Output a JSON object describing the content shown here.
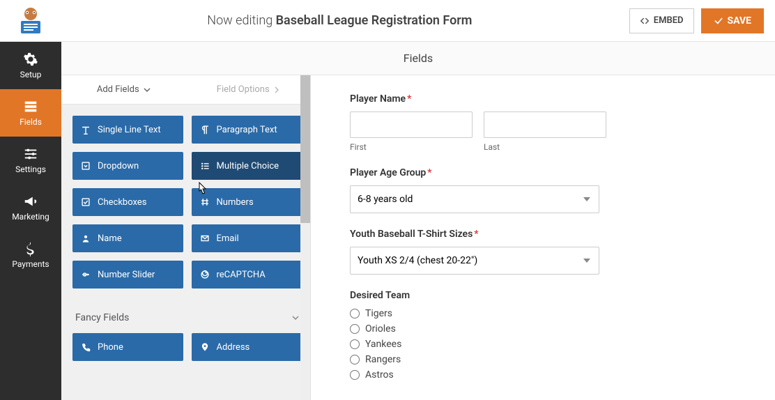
{
  "header": {
    "editing_prefix": "Now editing ",
    "form_title": "Baseball League Registration Form",
    "embed_label": "EMBED",
    "save_label": "SAVE"
  },
  "sidenav": {
    "items": [
      {
        "label": "Setup",
        "icon": "gear"
      },
      {
        "label": "Fields",
        "icon": "form"
      },
      {
        "label": "Settings",
        "icon": "sliders"
      },
      {
        "label": "Marketing",
        "icon": "bullhorn"
      },
      {
        "label": "Payments",
        "icon": "dollar"
      }
    ]
  },
  "panel_title": "Fields",
  "left": {
    "tab_add": "Add Fields",
    "tab_options": "Field Options",
    "standard_fields": [
      {
        "label": "Single Line Text",
        "icon": "text"
      },
      {
        "label": "Paragraph Text",
        "icon": "paragraph"
      },
      {
        "label": "Dropdown",
        "icon": "caret-square"
      },
      {
        "label": "Multiple Choice",
        "icon": "list"
      },
      {
        "label": "Checkboxes",
        "icon": "check-square"
      },
      {
        "label": "Numbers",
        "icon": "hash"
      },
      {
        "label": "Name",
        "icon": "user"
      },
      {
        "label": "Email",
        "icon": "mail"
      },
      {
        "label": "Number Slider",
        "icon": "slider"
      },
      {
        "label": "reCAPTCHA",
        "icon": "google"
      }
    ],
    "fancy_section": "Fancy Fields",
    "fancy_fields": [
      {
        "label": "Phone",
        "icon": "phone"
      },
      {
        "label": "Address",
        "icon": "pin"
      }
    ]
  },
  "form": {
    "player_name": {
      "label": "Player Name",
      "first_sub": "First",
      "last_sub": "Last"
    },
    "age_group": {
      "label": "Player Age Group",
      "value": "6-8 years old"
    },
    "tshirt": {
      "label": "Youth Baseball T-Shirt Sizes",
      "value": "Youth XS  2/4 (chest 20-22\")"
    },
    "team": {
      "label": "Desired Team",
      "options": [
        "Tigers",
        "Orioles",
        "Yankees",
        "Rangers",
        "Astros"
      ]
    }
  },
  "colors": {
    "accent": "#e27627",
    "field_btn": "#2a6aa8"
  }
}
